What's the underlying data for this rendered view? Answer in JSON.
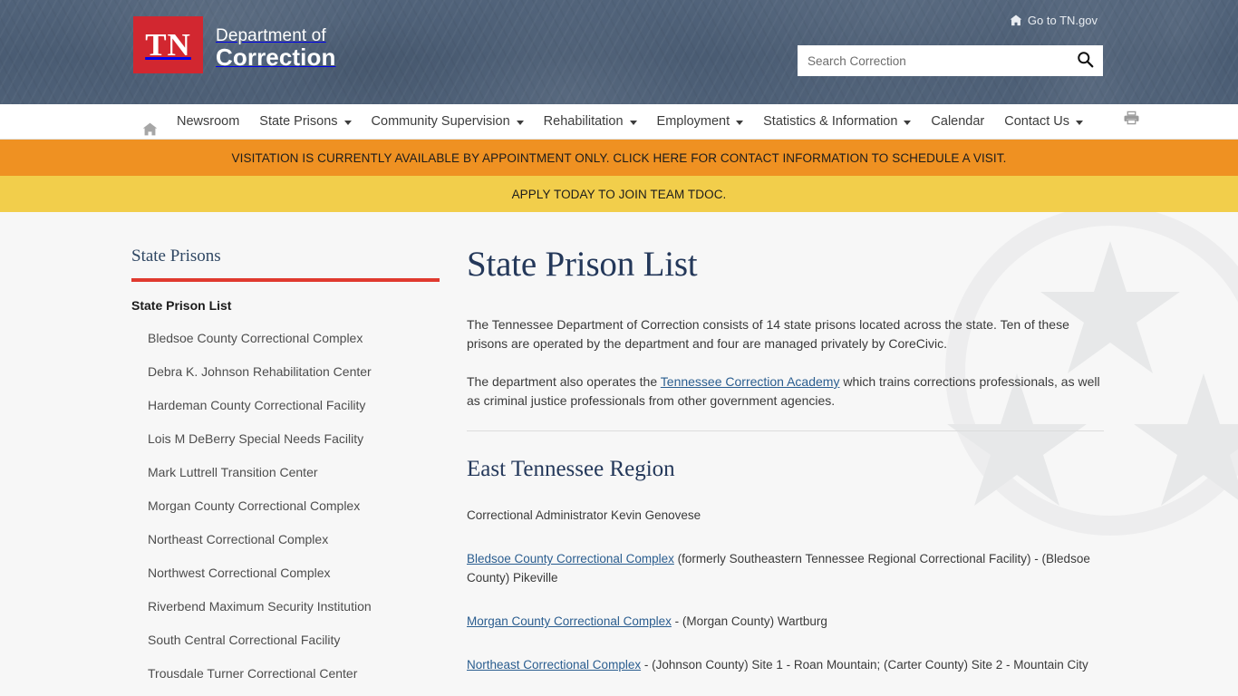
{
  "header": {
    "logo": {
      "mark_text": "TN",
      "dept_line1": "Department of",
      "dept_line2": "Correction"
    },
    "tngov_link": "Go to TN.gov",
    "tngov_icon": "home-icon",
    "search": {
      "placeholder": "Search Correction",
      "value": "",
      "submit_icon": "search-icon"
    },
    "brand_colors": {
      "red": "#d22730",
      "navy": "#16366b",
      "header_bg": "#4c5f77"
    }
  },
  "nav": {
    "home_icon": "home-icon",
    "print_icon": "printer-icon",
    "items": [
      {
        "label": "Newsroom",
        "has_caret": false
      },
      {
        "label": "State Prisons",
        "has_caret": true
      },
      {
        "label": "Community Supervision",
        "has_caret": true
      },
      {
        "label": "Rehabilitation",
        "has_caret": true
      },
      {
        "label": "Employment",
        "has_caret": true
      },
      {
        "label": "Statistics & Information",
        "has_caret": true
      },
      {
        "label": "Calendar",
        "has_caret": false
      },
      {
        "label": "Contact Us",
        "has_caret": true
      }
    ]
  },
  "alerts": [
    {
      "text": "VISITATION IS CURRENTLY AVAILABLE BY APPOINTMENT ONLY. CLICK HERE FOR CONTACT INFORMATION TO SCHEDULE A VISIT.",
      "color": "#ef9122"
    },
    {
      "text": "APPLY TODAY TO JOIN TEAM TDOC.",
      "color": "#f2ce4b"
    }
  ],
  "sidebar": {
    "title": "State Prisons",
    "accent_color": "#e03a2f",
    "head_link": "State Prison List",
    "items": [
      {
        "label": "Bledsoe County Correctional Complex"
      },
      {
        "label": "Debra K. Johnson Rehabilitation Center"
      },
      {
        "label": "Hardeman County Correctional Facility"
      },
      {
        "label": "Lois M DeBerry Special Needs Facility"
      },
      {
        "label": "Mark Luttrell Transition Center"
      },
      {
        "label": "Morgan County Correctional Complex"
      },
      {
        "label": "Northeast Correctional Complex"
      },
      {
        "label": "Northwest Correctional Complex"
      },
      {
        "label": "Riverbend Maximum Security Institution"
      },
      {
        "label": "South Central Correctional Facility"
      },
      {
        "label": "Trousdale Turner Correctional Center"
      }
    ]
  },
  "main": {
    "title": "State Prison List",
    "intro_p1": "The Tennessee Department of Correction consists of 14 state prisons located across the state.  Ten of these prisons are operated by the department and four are managed privately by CoreCivic.",
    "intro_p2_before": "The department also operates the ",
    "intro_p2_link": "Tennessee Correction Academy",
    "intro_p2_after": " which trains corrections professionals, as well as criminal justice professionals from other government agencies.",
    "region": {
      "title": "East Tennessee Region",
      "administrator": "Correctional Administrator Kevin Genovese",
      "entries": [
        {
          "link": "Bledsoe County Correctional Complex",
          "detail": " (formerly Southeastern Tennessee Regional Correctional Facility) - (Bledsoe County) Pikeville"
        },
        {
          "link": "Morgan County Correctional Complex",
          "detail": " - (Morgan County) Wartburg"
        },
        {
          "link": "Northeast Correctional Complex",
          "detail": " - (Johnson County) Site 1 - Roan Mountain; (Carter County) Site 2 - Mountain City"
        }
      ]
    }
  }
}
